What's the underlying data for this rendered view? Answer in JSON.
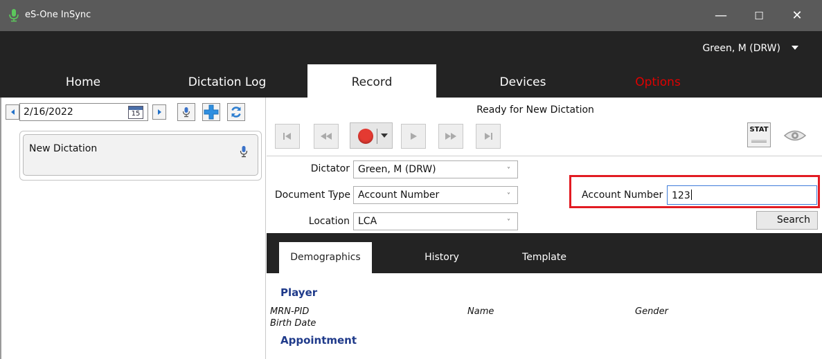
{
  "window": {
    "title": "eS-One InSync",
    "controls": {
      "minimize": "—",
      "maximize": "☐",
      "close": "✕"
    }
  },
  "user": {
    "name": "Green, M (DRW)"
  },
  "main_tabs": [
    {
      "label": "Home"
    },
    {
      "label": "Dictation Log"
    },
    {
      "label": "Record",
      "active": true
    },
    {
      "label": "Devices"
    },
    {
      "label": "Options",
      "color": "#e00000"
    }
  ],
  "left": {
    "date": "2/16/2022",
    "calendar_day": "15",
    "items": [
      {
        "label": "New Dictation"
      }
    ]
  },
  "record": {
    "status": "Ready for New Dictation",
    "stat_label": "STAT"
  },
  "form": {
    "dictator": {
      "label": "Dictator",
      "value": "Green, M (DRW)"
    },
    "document_type": {
      "label": "Document Type",
      "value": "Account Number"
    },
    "location": {
      "label": "Location",
      "value": "LCA"
    },
    "account_number": {
      "label": "Account Number",
      "value": "123"
    },
    "search_label": "Search",
    "dropdown_caret": "˅"
  },
  "lower_tabs": [
    {
      "label": "Demographics",
      "active": true
    },
    {
      "label": "History"
    },
    {
      "label": "Template"
    }
  ],
  "demographics": {
    "player_title": "Player",
    "fields": {
      "mrn_pid": "MRN-PID",
      "name": "Name",
      "gender": "Gender",
      "birth_date": "Birth Date"
    },
    "appointment_title": "Appointment"
  },
  "colors": {
    "accent_red": "#e21b22",
    "record_red": "#e43a32",
    "section_blue": "#1f3a8a",
    "toolbar_blue": "#2070c8"
  }
}
